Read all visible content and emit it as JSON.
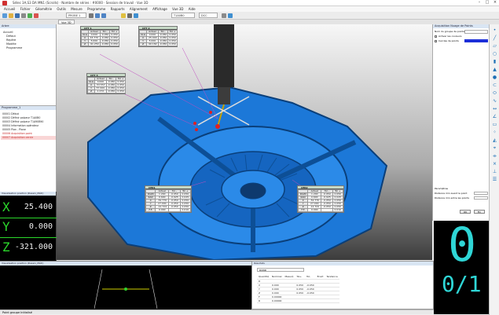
{
  "window": {
    "title": "Sélec 3A,S3 DA MN1 (Scrolls) · Nombre de séries : #0000 · Session de travail · Vue 3D"
  },
  "menu": [
    "Accueil",
    "Fichier",
    "Géométrie",
    "Outils",
    "Mesure",
    "Programme",
    "Rapports",
    "Alignement",
    "Affichage",
    "Vue 3D",
    "Aide"
  ],
  "toolbar": {
    "probe_field": "PROBE 1",
    "tip_field": "T1A0B0",
    "mode_field": "DCC"
  },
  "tabs": {
    "view_tab": "Vue 3D"
  },
  "tree": {
    "title": "Arbre",
    "items": [
      "Accueil",
      "Défaut",
      "Repère",
      "Modèle",
      "Programme"
    ]
  },
  "program": {
    "title": "Programme_1",
    "rows": [
      {
        "id": "00001",
        "text": "Début"
      },
      {
        "id": "00002",
        "text": "Définir palpeur T1A0B0"
      },
      {
        "id": "00003",
        "text": "Définir palpeur T1A90B90"
      },
      {
        "id": "00004",
        "text": "Information opérateur"
      },
      {
        "id": "00005",
        "text": "Plan - Plane"
      },
      {
        "id": "00006",
        "text": "Acquisition point"
      },
      {
        "id": "00007",
        "text": "Acquisition cercle"
      }
    ]
  },
  "dro": {
    "title": "Visualisation position (Dessin_Métr)",
    "axes": [
      {
        "axis": "X",
        "value": "25.400"
      },
      {
        "axis": "Y",
        "value": "0.000"
      },
      {
        "axis": "Z",
        "value": "-321.000"
      }
    ]
  },
  "feature_tables": [
    {
      "name": "CPT 1",
      "header": [
        "",
        "Actuel",
        "Tol -",
        "Tol +"
      ],
      "rows": [
        [
          "XLG",
          "0.000",
          "-0.050",
          "0.050"
        ],
        [
          "X",
          "43.770",
          "-0.050",
          "0.050"
        ],
        [
          "Y",
          "5.000",
          "-0.050",
          "0.050"
        ],
        [
          "Z",
          "-91.250",
          "-0.050",
          "0.050"
        ]
      ]
    },
    {
      "name": "CPT 2",
      "header": [
        "",
        "Actuel",
        "Tol -",
        "Tol +"
      ],
      "rows": [
        [
          "XLG",
          "0.000",
          "-0.050",
          "0.050"
        ],
        [
          "X",
          "-25.000",
          "-0.050",
          "0.050"
        ],
        [
          "Y",
          "5.000",
          "-0.050",
          "0.050"
        ],
        [
          "Z",
          "-90.182",
          "-0.050",
          "0.050"
        ]
      ]
    },
    {
      "name": "CPT 3",
      "header": [
        "",
        "Actuel",
        "Tol -",
        "Tol +"
      ],
      "rows": [
        [
          "XLG",
          "0.000",
          "-0.050",
          "0.050"
        ],
        [
          "X",
          "-53.557",
          "-0.050",
          "0.050"
        ],
        [
          "Y",
          "57.000",
          "-0.050",
          "0.050"
        ],
        [
          "Z",
          "1.272",
          "-0.050",
          "0.050"
        ]
      ]
    },
    {
      "name": "CER1",
      "header": [
        "",
        "Actuel",
        "Tol -",
        "Tol +"
      ],
      "rows": [
        [
          "DIAM",
          "1.200",
          "-0.050",
          "0.050"
        ],
        [
          "RAD",
          "0.600",
          "-0.025",
          "0.025"
        ],
        [
          "X",
          "-52.770",
          "-0.050",
          "0.050"
        ],
        [
          "Y",
          "27.000",
          "-0.050",
          "0.050"
        ],
        [
          "Z",
          "-12.724",
          "-0.050",
          "0.050"
        ],
        [
          "F.F.",
          "0.000",
          "",
          "0.010"
        ]
      ]
    },
    {
      "name": "CER2",
      "header": [
        "",
        "Actuel",
        "Tol -",
        "Tol +"
      ],
      "rows": [
        [
          "DIAM",
          "1.200",
          "-0.050",
          "0.050"
        ],
        [
          "RAD",
          "0.600",
          "-0.025",
          "0.025"
        ],
        [
          "X",
          "-52.770",
          "-0.050",
          "0.050"
        ],
        [
          "Y",
          "27.000",
          "-0.050",
          "0.050"
        ],
        [
          "Z",
          "-12.724",
          "-0.050",
          "0.050"
        ],
        [
          "F.F.",
          "0.000",
          "",
          "0.010"
        ]
      ]
    }
  ],
  "right_panel": {
    "title": "Acquisition Nuage de Points",
    "label_group": "Nom du groupe de points",
    "check_color": "Activer les couleurs",
    "check_points": "Cercles de points",
    "params_title": "Paramètres",
    "param1": "Distance min avant le point",
    "param2": "Distance min entre les points",
    "ok": "OK",
    "cancel": "Fin"
  },
  "big_display": {
    "digit": "0",
    "fraction": "0/1"
  },
  "bottom_view": {
    "title": "Visualisation position (Dessin_Métr)"
  },
  "results": {
    "title": "Résultats",
    "selector": "ROND",
    "headers": [
      "Quantité",
      "Nominal",
      "Mesuré",
      "Tol+",
      "Tol-",
      "Écart",
      "Tendance"
    ],
    "rows": [
      [
        "D",
        "",
        "",
        "",
        "",
        "",
        ""
      ],
      [
        "X",
        "0.000",
        "",
        "0.050",
        "-0.050",
        "",
        ""
      ],
      [
        "Y",
        "0.000",
        "",
        "0.050",
        "-0.050",
        "",
        ""
      ],
      [
        "Z",
        "0.000",
        "",
        "0.050",
        "-0.050",
        "",
        ""
      ],
      [
        "F",
        "0.00000",
        "",
        "",
        "",
        "",
        ""
      ],
      [
        "R",
        "0.00000",
        "",
        "",
        "",
        "",
        ""
      ]
    ]
  },
  "status": {
    "text": "Point groupe Initialisé"
  },
  "colors": {
    "part": "#1c78d8",
    "dro_green": "#2bd82b",
    "lcd_cyan": "#2fd6d6",
    "accent": "#1c6fb5"
  }
}
